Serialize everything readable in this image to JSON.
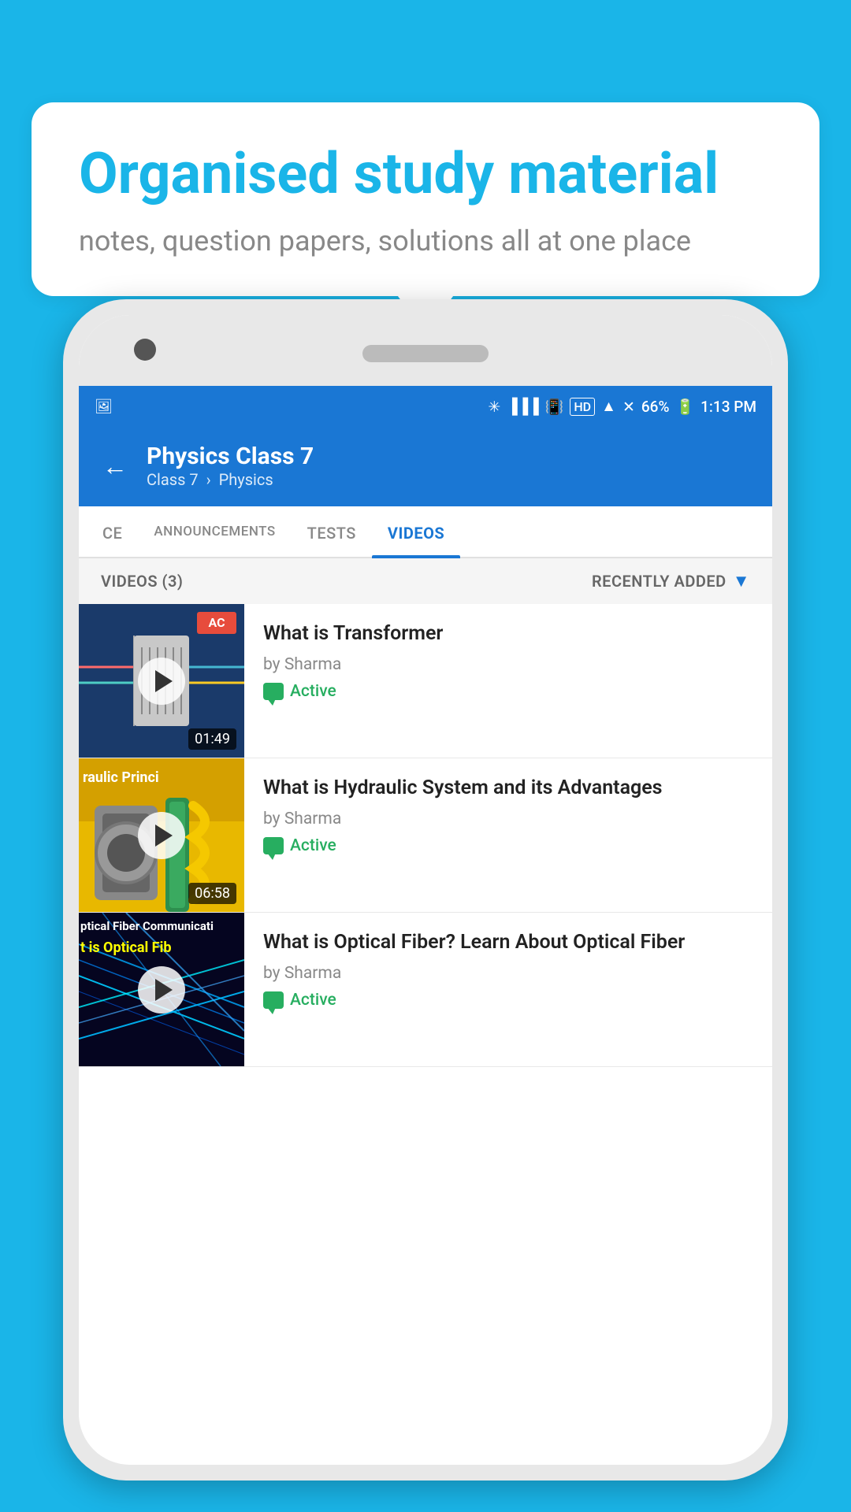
{
  "page": {
    "background_color": "#1ab5e8"
  },
  "speech_bubble": {
    "title": "Organised study material",
    "subtitle": "notes, question papers, solutions all at one place"
  },
  "status_bar": {
    "time": "1:13 PM",
    "battery": "66%",
    "signal_icons": "●●●●"
  },
  "app_header": {
    "title": "Physics Class 7",
    "breadcrumb_class": "Class 7",
    "breadcrumb_subject": "Physics",
    "back_label": "←"
  },
  "tabs": [
    {
      "id": "ce",
      "label": "CE",
      "active": false
    },
    {
      "id": "announcements",
      "label": "ANNOUNCEMENTS",
      "active": false
    },
    {
      "id": "tests",
      "label": "TESTS",
      "active": false
    },
    {
      "id": "videos",
      "label": "VIDEOS",
      "active": true
    }
  ],
  "videos_section": {
    "count_label": "VIDEOS (3)",
    "sort_label": "RECENTLY ADDED"
  },
  "videos": [
    {
      "id": 1,
      "title": "What is  Transformer",
      "author": "by Sharma",
      "duration": "01:49",
      "status": "Active",
      "thumbnail_type": "transformer",
      "badge": "AC"
    },
    {
      "id": 2,
      "title": "What is Hydraulic System and its Advantages",
      "author": "by Sharma",
      "duration": "06:58",
      "status": "Active",
      "thumbnail_type": "hydraulic",
      "thumbnail_text": "raulic Princi"
    },
    {
      "id": 3,
      "title": "What is Optical Fiber? Learn About Optical Fiber",
      "author": "by Sharma",
      "duration": "",
      "status": "Active",
      "thumbnail_type": "optical",
      "thumbnail_text": "ptical Fiber Communicati",
      "thumbnail_text2": "t is Optical Fib"
    }
  ]
}
